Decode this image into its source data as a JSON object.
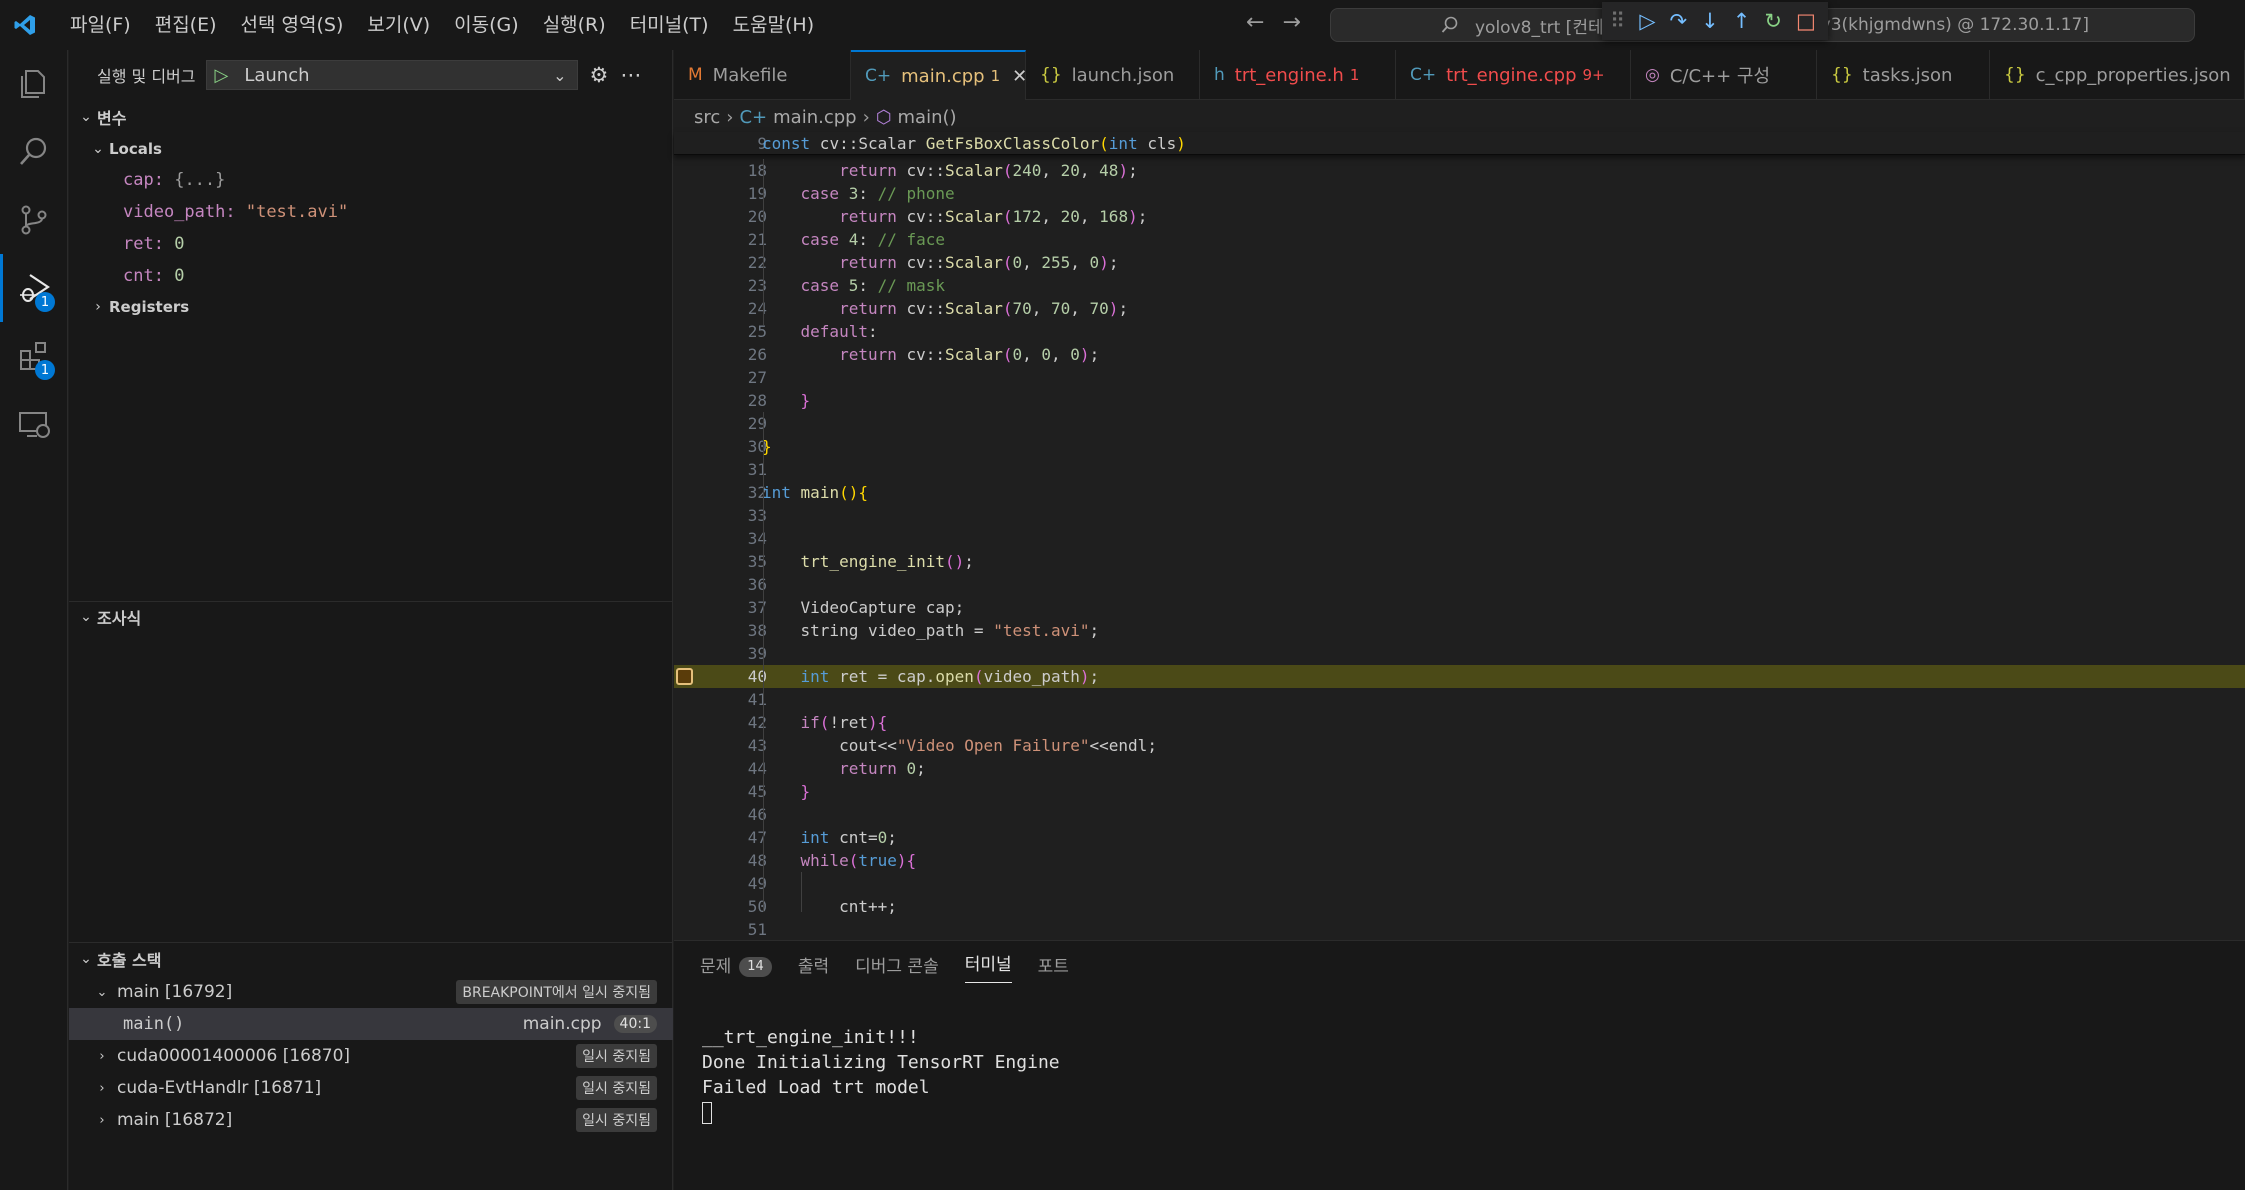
{
  "menu": [
    "파일(F)",
    "편집(E)",
    "선택 영역(S)",
    "보기(V)",
    "이동(G)",
    "실행(R)",
    "터미널(T)",
    "도움말(H)"
  ],
  "command_center": {
    "left": "yolov8_trt [컨테이",
    "right": "oy3(khjgmdwns) @ 172.30.1.17]"
  },
  "sidebar": {
    "title": "실행 및 디버그",
    "launch_config": "Launch",
    "variables_header": "변수",
    "locals_header": "Locals",
    "locals": [
      {
        "name": "cap",
        "value": "{...}"
      },
      {
        "name": "video_path",
        "value": "\"test.avi\""
      },
      {
        "name": "ret",
        "value": "0"
      },
      {
        "name": "cnt",
        "value": "0"
      }
    ],
    "registers_header": "Registers",
    "watch_header": "조사식",
    "callstack_header": "호출 스택",
    "callstack": [
      {
        "name": "main [16792]",
        "status": "BREAKPOINT에서 일시 중지됨"
      },
      {
        "name": "main()",
        "file": "main.cpp",
        "pos": "40:1"
      },
      {
        "name": "cuda00001400006 [16870]",
        "status": "일시 중지됨"
      },
      {
        "name": "cuda-EvtHandlr [16871]",
        "status": "일시 중지됨"
      },
      {
        "name": "main [16872]",
        "status": "일시 중지됨"
      }
    ]
  },
  "activity": {
    "debug_badge": "1",
    "ext_badge": "1"
  },
  "tabs": [
    {
      "label": "Makefile",
      "icon": "makefile-icon",
      "mod": ""
    },
    {
      "label": "main.cpp",
      "icon": "cpp-icon",
      "mod": "1"
    },
    {
      "label": "launch.json",
      "icon": "json-icon",
      "mod": ""
    },
    {
      "label": "trt_engine.h",
      "icon": "h-icon",
      "mod": "1"
    },
    {
      "label": "trt_engine.cpp",
      "icon": "cpp-icon",
      "mod": "9+"
    },
    {
      "label": "C/C++ 구성",
      "icon": "cpp-config-icon",
      "mod": ""
    },
    {
      "label": "tasks.json",
      "icon": "json-icon",
      "mod": ""
    },
    {
      "label": "c_cpp_properties.json",
      "icon": "json-icon",
      "mod": ""
    }
  ],
  "breadcrumb": {
    "folder": "src",
    "file": "main.cpp",
    "symbol": "main()"
  },
  "code": {
    "sticky_line": {
      "num": "9",
      "text": "const cv::Scalar GetFsBoxClassColor(int cls)"
    },
    "current_line": "40"
  },
  "panel": {
    "tabs": [
      "문제",
      "출력",
      "디버그 콘솔",
      "터미널",
      "포트"
    ],
    "problems_count": "14",
    "terminal_lines": [
      "",
      "__trt_engine_init!!!",
      "Done Initializing TensorRT Engine",
      "Failed Load trt model"
    ]
  }
}
